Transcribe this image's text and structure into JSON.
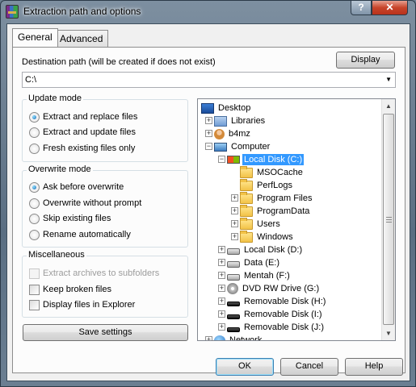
{
  "window": {
    "title": "Extraction path and options",
    "help_glyph": "?",
    "close_glyph": "✕"
  },
  "tabs": [
    {
      "label": "General",
      "active": true
    },
    {
      "label": "Advanced",
      "active": false
    }
  ],
  "destination": {
    "label": "Destination path (will be created if does not exist)",
    "value": "C:\\",
    "display_button": "Display"
  },
  "update_mode": {
    "title": "Update mode",
    "options": [
      {
        "label": "Extract and replace files",
        "selected": true
      },
      {
        "label": "Extract and update files",
        "selected": false
      },
      {
        "label": "Fresh existing files only",
        "selected": false
      }
    ]
  },
  "overwrite_mode": {
    "title": "Overwrite mode",
    "options": [
      {
        "label": "Ask before overwrite",
        "selected": true
      },
      {
        "label": "Overwrite without prompt",
        "selected": false
      },
      {
        "label": "Skip existing files",
        "selected": false
      },
      {
        "label": "Rename automatically",
        "selected": false
      }
    ]
  },
  "misc": {
    "title": "Miscellaneous",
    "options": [
      {
        "label": "Extract archives to subfolders",
        "checked": false,
        "enabled": false
      },
      {
        "label": "Keep broken files",
        "checked": false,
        "enabled": true
      },
      {
        "label": "Display files in Explorer",
        "checked": false,
        "enabled": true
      }
    ]
  },
  "save_settings": "Save settings",
  "tree": [
    {
      "label": "Desktop",
      "icon": "desktop-icon",
      "expander": ""
    },
    {
      "label": "Libraries",
      "icon": "libraries-icon",
      "expander": "+"
    },
    {
      "label": "b4mz",
      "icon": "user-folder-icon",
      "expander": "+"
    },
    {
      "label": "Computer",
      "icon": "computer-icon",
      "expander": "−"
    },
    {
      "label": "Local Disk (C:)",
      "icon": "system-drive-icon",
      "expander": "−",
      "selected": true
    },
    {
      "label": "MSOCache",
      "icon": "folder-icon",
      "expander": ""
    },
    {
      "label": "PerfLogs",
      "icon": "folder-icon",
      "expander": ""
    },
    {
      "label": "Program Files",
      "icon": "folder-icon",
      "expander": "+"
    },
    {
      "label": "ProgramData",
      "icon": "folder-icon",
      "expander": "+"
    },
    {
      "label": "Users",
      "icon": "folder-icon",
      "expander": "+"
    },
    {
      "label": "Windows",
      "icon": "folder-icon",
      "expander": "+"
    },
    {
      "label": "Local Disk (D:)",
      "icon": "drive-icon",
      "expander": "+"
    },
    {
      "label": "Data (E:)",
      "icon": "drive-icon",
      "expander": "+"
    },
    {
      "label": "Mentah (F:)",
      "icon": "drive-icon",
      "expander": "+"
    },
    {
      "label": "DVD RW Drive (G:)",
      "icon": "dvd-drive-icon",
      "expander": "+"
    },
    {
      "label": "Removable Disk (H:)",
      "icon": "removable-drive-icon",
      "expander": "+"
    },
    {
      "label": "Removable Disk (I:)",
      "icon": "removable-drive-icon",
      "expander": "+"
    },
    {
      "label": "Removable Disk (J:)",
      "icon": "removable-drive-icon",
      "expander": "+"
    },
    {
      "label": "Network",
      "icon": "network-icon",
      "expander": "+"
    }
  ],
  "buttons": {
    "ok": "OK",
    "cancel": "Cancel",
    "help": "Help"
  },
  "colors": {
    "selection": "#3399ff",
    "close_button": "#c7442a"
  }
}
